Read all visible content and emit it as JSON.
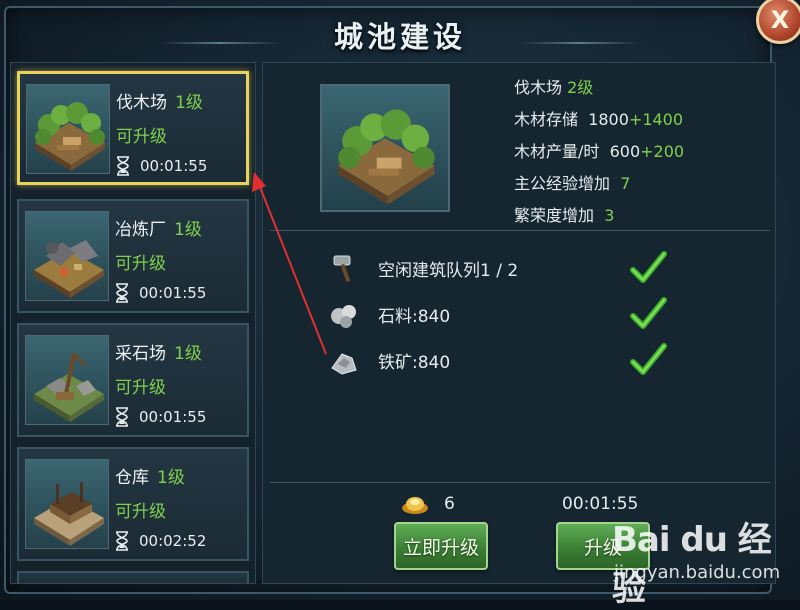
{
  "dialog": {
    "title": "城池建设",
    "close_icon": "close-icon",
    "close_label": "X"
  },
  "buildings": [
    {
      "name": "伐木场",
      "level": "1级",
      "status": "可升级",
      "time": "00:01:55",
      "icon": "lumber-mill-icon",
      "selected": true
    },
    {
      "name": "冶炼厂",
      "level": "1级",
      "status": "可升级",
      "time": "00:01:55",
      "icon": "smelter-icon",
      "selected": false
    },
    {
      "name": "采石场",
      "level": "1级",
      "status": "可升级",
      "time": "00:01:55",
      "icon": "quarry-icon",
      "selected": false
    },
    {
      "name": "仓库",
      "level": "1级",
      "status": "可升级",
      "time": "00:02:52",
      "icon": "warehouse-icon",
      "selected": false
    }
  ],
  "detail": {
    "name": "伐木场",
    "level": "2级",
    "stats": [
      {
        "label": "木材存储",
        "value": "1800",
        "bonus": "+1400"
      },
      {
        "label": "木材产量/时",
        "value": "600",
        "bonus": "+200"
      },
      {
        "label": "主公经验增加",
        "value": "",
        "bonus": "7"
      },
      {
        "label": "繁荣度增加",
        "value": "",
        "bonus": "3"
      }
    ]
  },
  "requirements": [
    {
      "icon": "hammer-icon",
      "text": "空闲建筑队列1 / 2",
      "met": true
    },
    {
      "icon": "stone-icon",
      "text": "石料:840",
      "met": true
    },
    {
      "icon": "iron-ore-icon",
      "text": "铁矿:840",
      "met": true
    }
  ],
  "cost": {
    "gold_icon": "gold-ingot-icon",
    "gold": "6",
    "time": "00:01:55"
  },
  "buttons": {
    "instant": "立即升级",
    "upgrade": "升级"
  },
  "watermark": {
    "logo": "Bai du 经验",
    "url": "jingyan.baidu.com"
  },
  "colors": {
    "green": "#7fd14c",
    "selected_border": "#e9d35b",
    "arrow": "#e03030"
  }
}
